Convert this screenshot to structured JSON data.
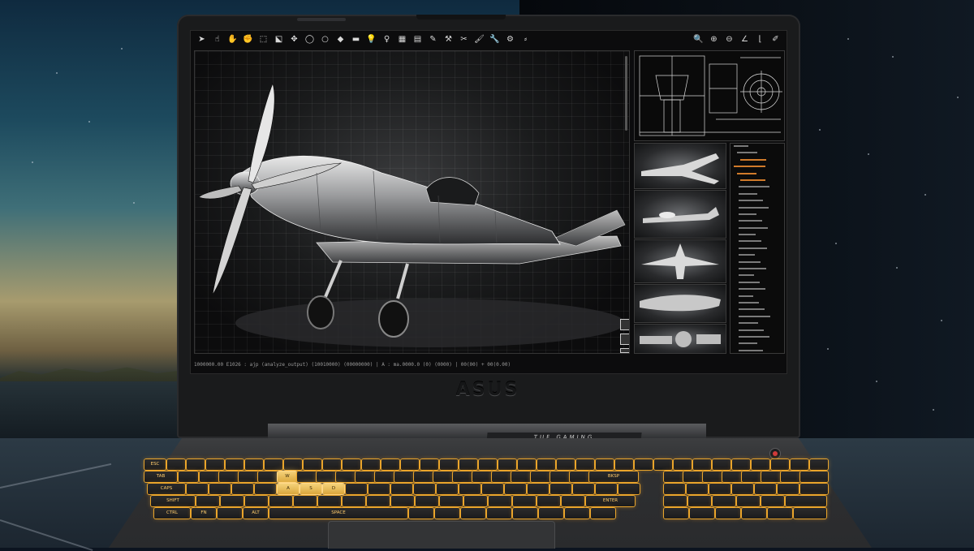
{
  "screen": {
    "toolbar_left_icons": [
      {
        "name": "select-arrow-icon",
        "glyph": "➤"
      },
      {
        "name": "hand-pointer-icon",
        "glyph": "☝"
      },
      {
        "name": "pan-hand-icon",
        "glyph": "✋"
      },
      {
        "name": "grab-hand-icon",
        "glyph": "✊"
      },
      {
        "name": "box-select-icon",
        "glyph": "⬚"
      },
      {
        "name": "lasso-select-icon",
        "glyph": "⬕"
      },
      {
        "name": "move-icon",
        "glyph": "✥"
      },
      {
        "name": "circle-icon",
        "glyph": "◯"
      },
      {
        "name": "ring-icon",
        "glyph": "○"
      },
      {
        "name": "fill-bucket-icon",
        "glyph": "◆"
      },
      {
        "name": "line-icon",
        "glyph": "▬"
      },
      {
        "name": "light-bulb-icon",
        "glyph": "💡"
      },
      {
        "name": "pin-icon",
        "glyph": "♀"
      },
      {
        "name": "grid-icon",
        "glyph": "▦"
      },
      {
        "name": "layers-icon",
        "glyph": "▤"
      },
      {
        "name": "pencil-icon",
        "glyph": "✎"
      },
      {
        "name": "hammer-icon",
        "glyph": "⚒"
      },
      {
        "name": "scissors-icon",
        "glyph": "✂"
      },
      {
        "name": "brush-icon",
        "glyph": "🖌"
      },
      {
        "name": "wrench-icon",
        "glyph": "🔧"
      },
      {
        "name": "tools-icon",
        "glyph": "⚙"
      },
      {
        "name": "knife-icon",
        "glyph": "⸗"
      }
    ],
    "toolbar_right_icons": [
      {
        "name": "search-icon",
        "glyph": "🔍"
      },
      {
        "name": "zoom-in-icon",
        "glyph": "⊕"
      },
      {
        "name": "zoom-out-icon",
        "glyph": "⊖"
      },
      {
        "name": "angle-icon",
        "glyph": "∠"
      },
      {
        "name": "corner-icon",
        "glyph": "⌊"
      },
      {
        "name": "settings-wrench-icon",
        "glyph": "✐"
      }
    ],
    "status_text": "1000000.00 E1026 : ajp (analyze_output) (10010000) (00000000)  |  A : ma.0000.0 (0) (0000)  |  00(00) + 00(0.00)",
    "viewport_subject": "silver propeller aircraft render",
    "view_cube_icons": [
      "cube-top-icon",
      "cube-side-icon",
      "cube-front-icon"
    ],
    "thumbnail_count": 5
  },
  "brand": {
    "logo_text": "ASUS",
    "hinge_label": "TUF GAMING"
  },
  "keyboard": {
    "wasd_keys": [
      "W",
      "A",
      "S",
      "D"
    ],
    "modifier_labels": [
      "ESC",
      "TAB",
      "CAPS",
      "SHIFT",
      "CTRL",
      "FN",
      "ALT",
      "SPACE",
      "ENTER",
      "BKSP"
    ]
  },
  "colors": {
    "keyboard_backlight": "#e9a52c",
    "power_led": "#d03a3a"
  }
}
